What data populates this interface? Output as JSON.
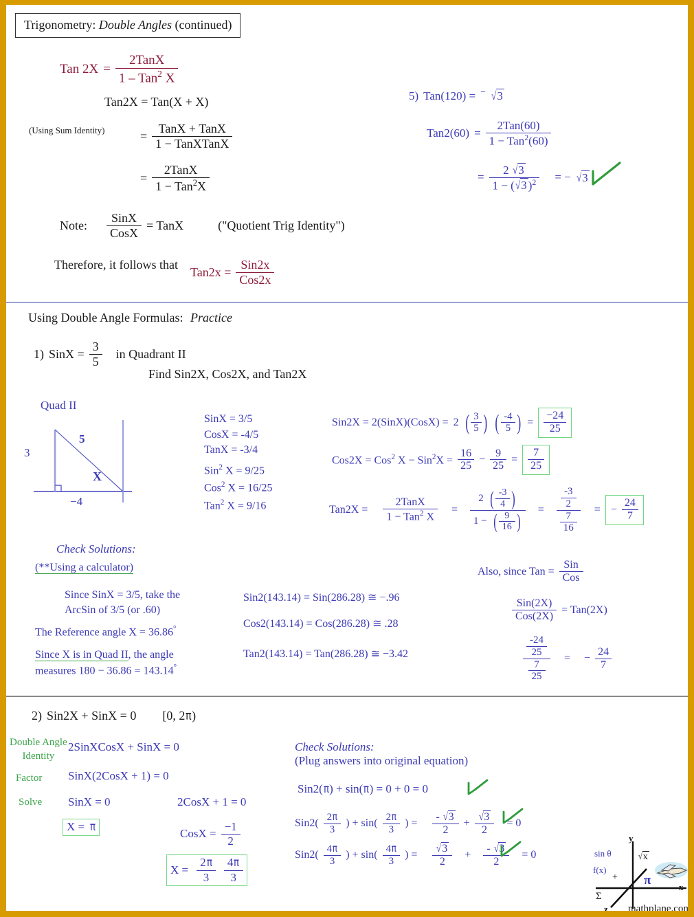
{
  "page": {
    "title": "Trigonometry: Double Angles (continued)",
    "title_parts": {
      "prefix": "Trigonometry:",
      "emphasis": "Double Angles",
      "suffix": "(continued)"
    },
    "border_color": "#d79b00",
    "colors": {
      "formula_red": "#8c1a3a",
      "work_blue": "#3b39b5",
      "check_green": "#2f9c3b",
      "label_green": "#3aa34a",
      "body_black": "#1a1a1a"
    }
  },
  "section1": {
    "identity": {
      "lhs": "Tan 2X",
      "eq": "=",
      "num": "2TanX",
      "den_pre": "1 – Tan",
      "den_exp": "2",
      "den_post": "X"
    },
    "derivation": {
      "line1": "Tan2X = Tan(X + X)",
      "note_label": "(Using Sum Identity)",
      "step1": {
        "eq": "=",
        "num": "TanX + TanX",
        "den": "1 − TanXTanX"
      },
      "step2": {
        "eq": "=",
        "num": "2TanX",
        "den_pre": "1 − Tan",
        "den_exp": "2",
        "den_post": "X"
      }
    },
    "note": {
      "label": "Note:",
      "num": "SinX",
      "den": "CosX",
      "equals": "= TanX",
      "parenthetical": "(\"Quotient Trig Identity\")"
    },
    "therefore": {
      "text": "Therefore, it follows that",
      "lhs": "Tan2x  =",
      "num": "Sin2x",
      "den": "Cos2x"
    },
    "example5": {
      "number": "5)",
      "statement_lhs": "Tan(120) =",
      "statement_sign": "−",
      "statement_rad": "3",
      "line1_lhs": "Tan2(60)",
      "line1_eq": "=",
      "line1_num": "2Tan(60)",
      "line1_den_pre": "1 − Tan",
      "line1_den_exp": "2",
      "line1_den_post": "(60)",
      "line2_eq": "=",
      "line2_num_coef": "2",
      "line2_num_rad": "3",
      "line2_den_pre": "1 − (",
      "line2_den_rad": "3",
      "line2_den_post": ")",
      "line2_den_exp": "2",
      "result": "= −",
      "result_rad": "3",
      "check": "check-mark"
    }
  },
  "section2": {
    "heading_prefix": "Using Double Angle Formulas:",
    "heading_emphasis": "Practice",
    "problem": {
      "number": "1)",
      "lhs": "SinX =",
      "frac_num": "3",
      "frac_den": "5",
      "quadrant": "in Quadrant II",
      "find": "Find  Sin2X, Cos2X, and Tan2X"
    },
    "diagram": {
      "label": "Quad II",
      "opposite": "3",
      "adjacent": "−4",
      "hypotenuse": "5",
      "angle": "X"
    },
    "values": [
      "SinX = 3/5",
      "CosX = -4/5",
      "TanX = -3/4"
    ],
    "squared_values": [
      {
        "fn": "Sin",
        "exp": "2",
        "rest": " X = 9/25"
      },
      {
        "fn": "Cos",
        "exp": "2",
        "rest": " X = 16/25"
      },
      {
        "fn": "Tan",
        "exp": "2",
        "rest": " X = 9/16"
      }
    ],
    "sin2x": {
      "lhs": "Sin2X = 2(SinX)(CosX) =",
      "coef": "2",
      "f1_num": "3",
      "f1_den": "5",
      "f2_num": "-4",
      "f2_den": "5",
      "eq": "=",
      "ans_num": "−24",
      "ans_den": "25"
    },
    "cos2x": {
      "lhs_a": "Cos2X =  Cos",
      "exp_a": "2",
      "lhs_b": " X  −  Sin",
      "exp_b": "2",
      "lhs_c": "X  =",
      "t1_num": "16",
      "t1_den": "25",
      "minus": "−",
      "t2_num": "9",
      "t2_den": "25",
      "eq": "=",
      "ans_num": "7",
      "ans_den": "25"
    },
    "tan2x": {
      "lhs": "Tan2X =",
      "f_num": "2TanX",
      "f_den_pre": "1 − Tan",
      "f_den_exp": "2",
      "f_den_post": " X",
      "eq1": "=",
      "s_num_coef": "2",
      "s_num_num": "-3",
      "s_num_den": "4",
      "s_den_pre": "1 −",
      "s_den_num": "9",
      "s_den_den": "16",
      "eq2": "=",
      "c_num_num": "-3",
      "c_num_den": "2",
      "c_den_num": "7",
      "c_den_den": "16",
      "eq3": "=",
      "ans_sign": "−",
      "ans_num": "24",
      "ans_den": "7"
    },
    "check": {
      "title": "Check Solutions:",
      "subtitle": "(**Using a calculator)",
      "line1a": "Since SinX = 3/5,  take the",
      "line1b": "ArcSin of 3/5 (or .60)",
      "line2": "The Reference angle X = 36.86",
      "line2_deg": "°",
      "line3a": "Since X is in Quad II, the angle",
      "line3b": "measures 180 − 36.86 = 143.14",
      "line3_deg": "°",
      "calc": [
        "Sin2(143.14) = Sin(286.28) ≅ −.96",
        "Cos2(143.14) = Cos(286.28) ≅ .28",
        "Tan2(143.14) =  Tan(286.28) ≅ −3.42"
      ],
      "also": {
        "text": "Also, since  Tan =",
        "num": "Sin",
        "den": "Cos",
        "ratio_num": "Sin(2X)",
        "ratio_den": "Cos(2X)",
        "ratio_eq": "= Tan(2X)",
        "big_num_num": "-24",
        "big_num_den": "25",
        "big_den_num": "7",
        "big_den_den": "25",
        "big_eq": "=",
        "big_sign": "−",
        "big_ans_num": "24",
        "big_ans_den": "7"
      }
    }
  },
  "section3": {
    "problem": {
      "number": "2)",
      "equation": "Sin2X + SinX = 0",
      "interval_open": "[0, 2",
      "interval_pi": "π",
      "interval_close": ")"
    },
    "labels": {
      "double_angle": "Double Angle",
      "identity": "Identity",
      "factor": "Factor",
      "solve": "Solve"
    },
    "steps": {
      "step1": "2SinXCosX + SinX = 0",
      "step2": "SinX(2CosX + 1) = 0",
      "step3_left": "SinX = 0",
      "step3_right": "2CosX + 1 = 0"
    },
    "answers": {
      "left_lhs": "X =",
      "left_pi": "π",
      "cos_lhs": "CosX =",
      "cos_num": "−1",
      "cos_den": "2",
      "right_lhs": "X =",
      "right_a_num_coef": "2",
      "right_a_num_pi": "π",
      "right_a_den": "3",
      "right_b_num_coef": "4",
      "right_b_num_pi": "π",
      "right_b_den": "3"
    },
    "check": {
      "title": "Check Solutions:",
      "subtitle": "(Plug answers into original equation)",
      "line1": {
        "pre": "Sin2(",
        "pi1": "π",
        "mid": ") + sin(",
        "pi2": "π",
        "post": ") = 0 + 0 = 0"
      },
      "line2": {
        "pre": "Sin2(",
        "n1": "2",
        "pi1": "π",
        "d1": "3",
        "mid": ") + sin(",
        "n2": "2",
        "pi2": "π",
        "d2": "3",
        "post": ") =",
        "r1_sign": "-",
        "r1_rad": "3",
        "r1_den": "2",
        "plus": "+",
        "r2_rad": "3",
        "r2_den": "2",
        "eq": "= 0"
      },
      "line3": {
        "pre": "Sin2(",
        "n1": "4",
        "pi1": "π",
        "d1": "3",
        "mid": ") + sin(",
        "n2": "4",
        "pi2": "π",
        "d2": "3",
        "post": ") =",
        "r1_rad": "3",
        "r1_den": "2",
        "plus": "+",
        "r2_sign": "-",
        "r2_rad": "3",
        "r2_den": "2",
        "eq": "= 0"
      }
    }
  },
  "logo": {
    "site": "mathplane.com",
    "axis_y": "y",
    "axis_x": "x",
    "axis_z": "z",
    "sin_theta": "sin θ",
    "fx": "f(x)",
    "sqrt_x": "x",
    "pi": "π",
    "sigma": "Σ",
    "plus": "+"
  }
}
